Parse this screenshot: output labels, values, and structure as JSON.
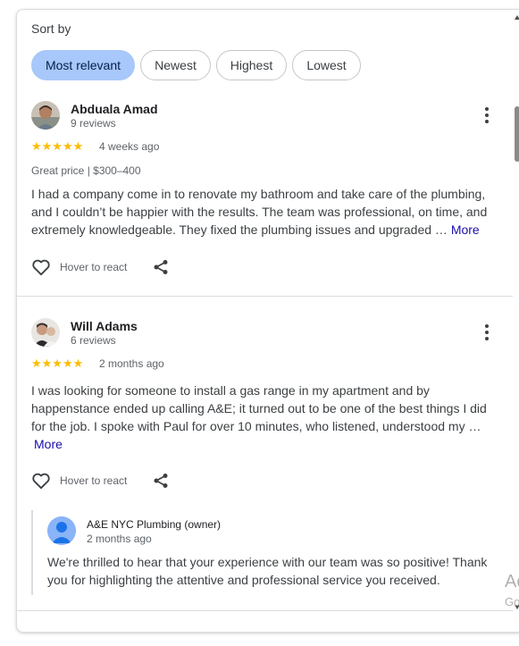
{
  "sort": {
    "label": "Sort by",
    "options": [
      "Most relevant",
      "Newest",
      "Highest",
      "Lowest"
    ],
    "selected": "Most relevant"
  },
  "reviews": [
    {
      "author": "Abduala Amad",
      "review_count": "9 reviews",
      "rating": 5,
      "stars": "★★★★★",
      "date": "4 weeks ago",
      "meta": "Great price  |  $300–400",
      "text": "I had a company come in to renovate my bathroom and take care of the plumbing, and I couldn’t be happier with the results. The team was professional, on time, and extremely knowledgeable. They fixed the plumbing issues and upgraded …",
      "more_label": "More",
      "react_label": "Hover to react"
    },
    {
      "author": "Will Adams",
      "review_count": "6 reviews",
      "rating": 5,
      "stars": "★★★★★",
      "date": "2 months ago",
      "text": "I was looking for someone to install a gas range in my apartment and by happenstance ended up calling A&E; it turned out to be one of the best things I did for the job. I spoke with Paul for over 10 minutes, who listened, understood my …",
      "more_label": "More",
      "react_label": "Hover to react",
      "owner_response": {
        "name": "A&E NYC Plumbing (owner)",
        "date": "2 months ago",
        "text": "We're thrilled to hear that your experience with our team was so positive! Thank you for highlighting the attentive and professional service you received."
      }
    }
  ],
  "colors": {
    "star": "#fbbc04",
    "chip_active": "#a8c7fa",
    "link": "#1a0dab",
    "divider": "#dadce0"
  },
  "icons": [
    "heart-outline-icon",
    "share-icon",
    "more-vert-icon",
    "avatar-icon"
  ],
  "watermark": {
    "line1": "Ac",
    "line2": "Go"
  }
}
